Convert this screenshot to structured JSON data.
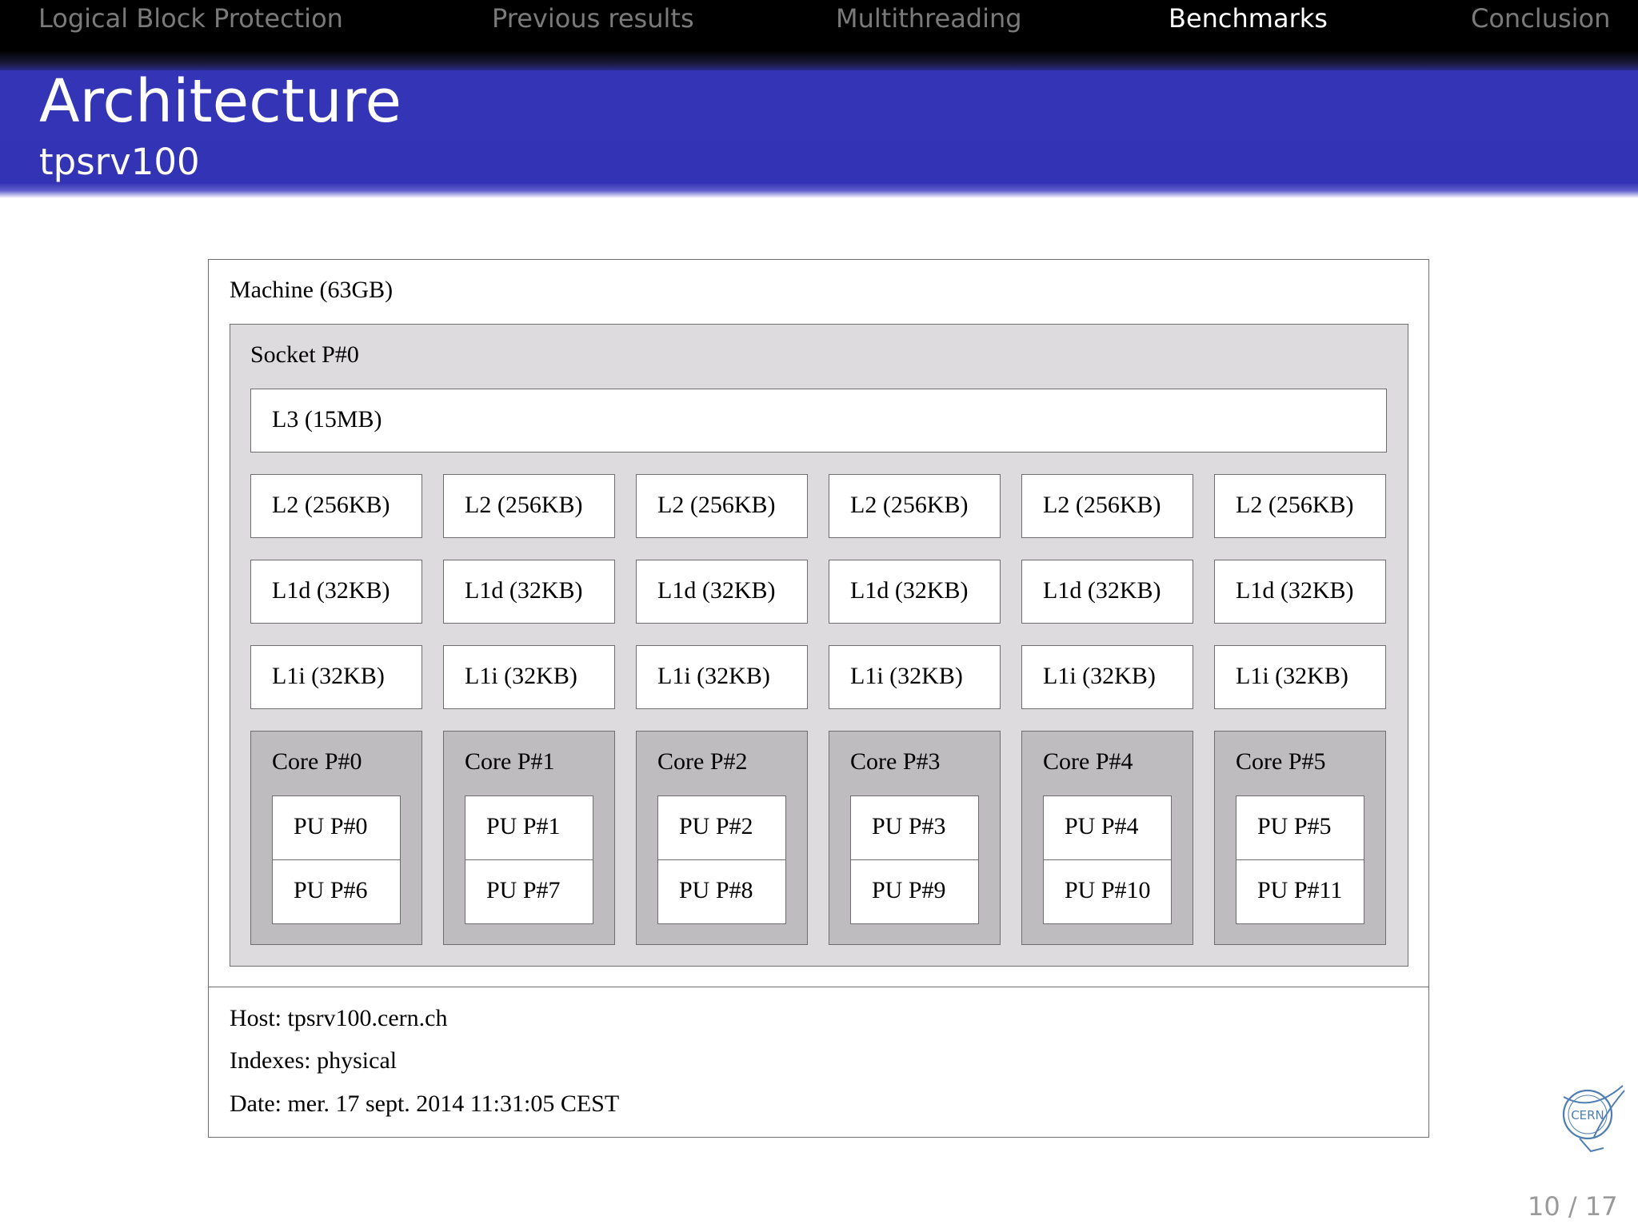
{
  "nav": {
    "items": [
      {
        "label": "Logical Block Protection",
        "active": false
      },
      {
        "label": "Previous results",
        "active": false
      },
      {
        "label": "Multithreading",
        "active": false
      },
      {
        "label": "Benchmarks",
        "active": true
      },
      {
        "label": "Conclusion",
        "active": false
      }
    ]
  },
  "slide": {
    "title": "Architecture",
    "subtitle": "tpsrv100",
    "page": "10 / 17",
    "logo_text": "CERN"
  },
  "topology": {
    "machine": "Machine (63GB)",
    "socket": "Socket P#0",
    "l3": "L3 (15MB)",
    "l2": [
      "L2 (256KB)",
      "L2 (256KB)",
      "L2 (256KB)",
      "L2 (256KB)",
      "L2 (256KB)",
      "L2 (256KB)"
    ],
    "l1d": [
      "L1d (32KB)",
      "L1d (32KB)",
      "L1d (32KB)",
      "L1d (32KB)",
      "L1d (32KB)",
      "L1d (32KB)"
    ],
    "l1i": [
      "L1i (32KB)",
      "L1i (32KB)",
      "L1i (32KB)",
      "L1i (32KB)",
      "L1i (32KB)",
      "L1i (32KB)"
    ],
    "cores": [
      {
        "label": "Core P#0",
        "pus": [
          "PU P#0",
          "PU P#6"
        ]
      },
      {
        "label": "Core P#1",
        "pus": [
          "PU P#1",
          "PU P#7"
        ]
      },
      {
        "label": "Core P#2",
        "pus": [
          "PU P#2",
          "PU P#8"
        ]
      },
      {
        "label": "Core P#3",
        "pus": [
          "PU P#3",
          "PU P#9"
        ]
      },
      {
        "label": "Core P#4",
        "pus": [
          "PU P#4",
          "PU P#10"
        ]
      },
      {
        "label": "Core P#5",
        "pus": [
          "PU P#5",
          "PU P#11"
        ]
      }
    ],
    "host": "Host: tpsrv100.cern.ch",
    "indexes": "Indexes: physical",
    "date": "Date: mer. 17 sept. 2014 11:31:05 CEST"
  }
}
